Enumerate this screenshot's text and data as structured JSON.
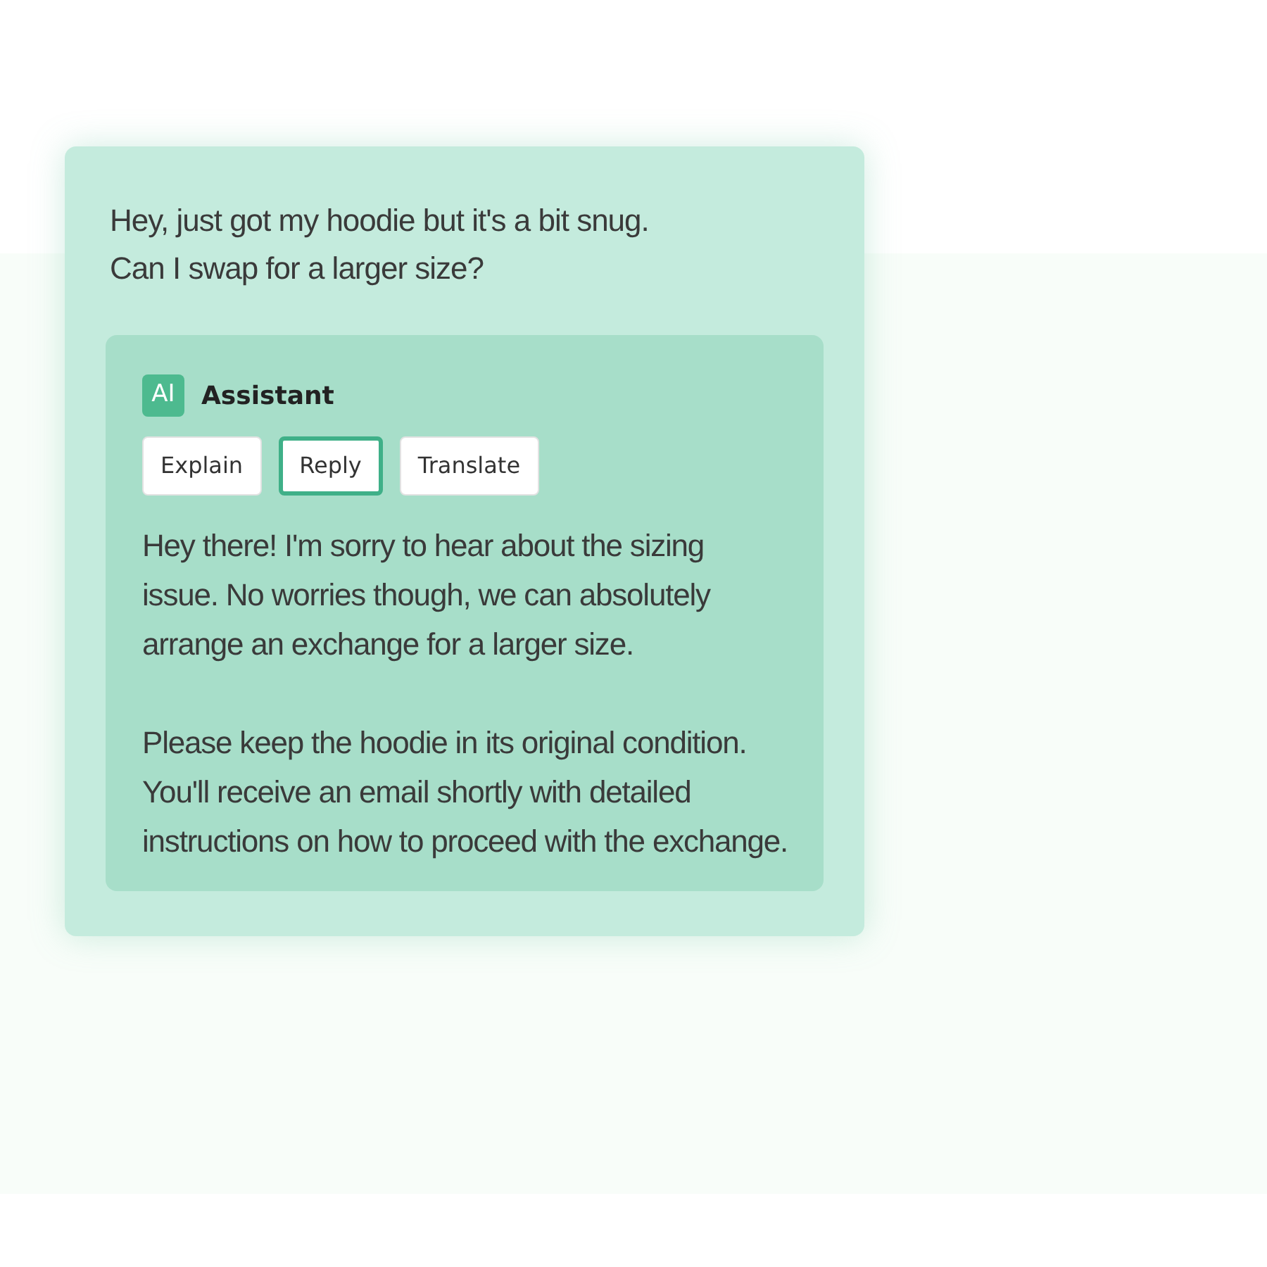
{
  "message": {
    "lines": [
      "Hey, just got my hoodie but it's a bit snug.",
      "Can I swap for a larger size?"
    ]
  },
  "assistant": {
    "badge": "AI",
    "name": "Assistant",
    "actions": [
      {
        "label": "Explain",
        "selected": false
      },
      {
        "label": "Reply",
        "selected": true
      },
      {
        "label": "Translate",
        "selected": false
      }
    ],
    "paragraphs": [
      [
        "Hey there! I'm sorry to hear about the sizing",
        "issue. No worries though, we can absolutely",
        "arrange an exchange for a larger size."
      ],
      [
        "Please keep the hoodie in its original condition.",
        "You'll receive an email shortly with detailed",
        "instructions on how to proceed with the exchange."
      ]
    ]
  }
}
